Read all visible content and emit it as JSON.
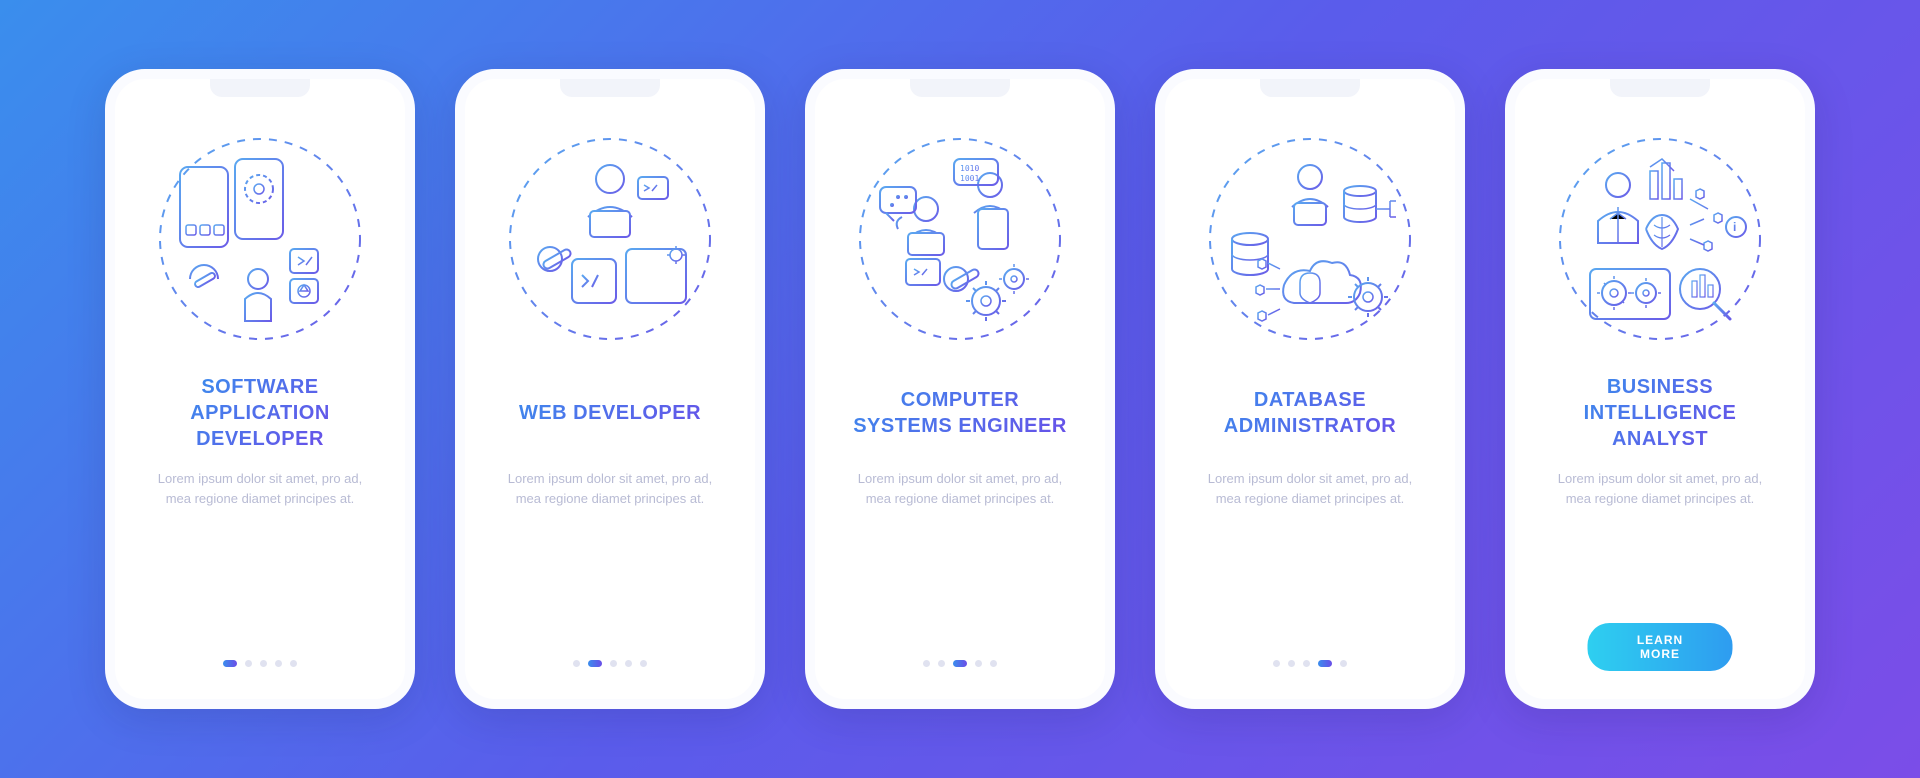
{
  "screens": [
    {
      "title": "SOFTWARE\nAPPLICATION\nDEVELOPER",
      "desc": "Lorem ipsum dolor sit amet, pro ad, mea regione diamet principes at.",
      "active": 0
    },
    {
      "title": "WEB DEVELOPER",
      "desc": "Lorem ipsum dolor sit amet, pro ad, mea regione diamet principes at.",
      "active": 1
    },
    {
      "title": "COMPUTER\nSYSTEMS ENGINEER",
      "desc": "Lorem ipsum dolor sit amet, pro ad, mea regione diamet principes at.",
      "active": 2
    },
    {
      "title": "DATABASE\nADMINISTRATOR",
      "desc": "Lorem ipsum dolor sit amet, pro ad, mea regione diamet principes at.",
      "active": 3
    },
    {
      "title": "BUSINESS\nINTELLIGENCE\nANALYST",
      "desc": "Lorem ipsum dolor sit amet, pro ad, mea regione diamet principes at.",
      "active": 4
    }
  ],
  "cta_label": "LEARN MORE",
  "dot_count": 5
}
